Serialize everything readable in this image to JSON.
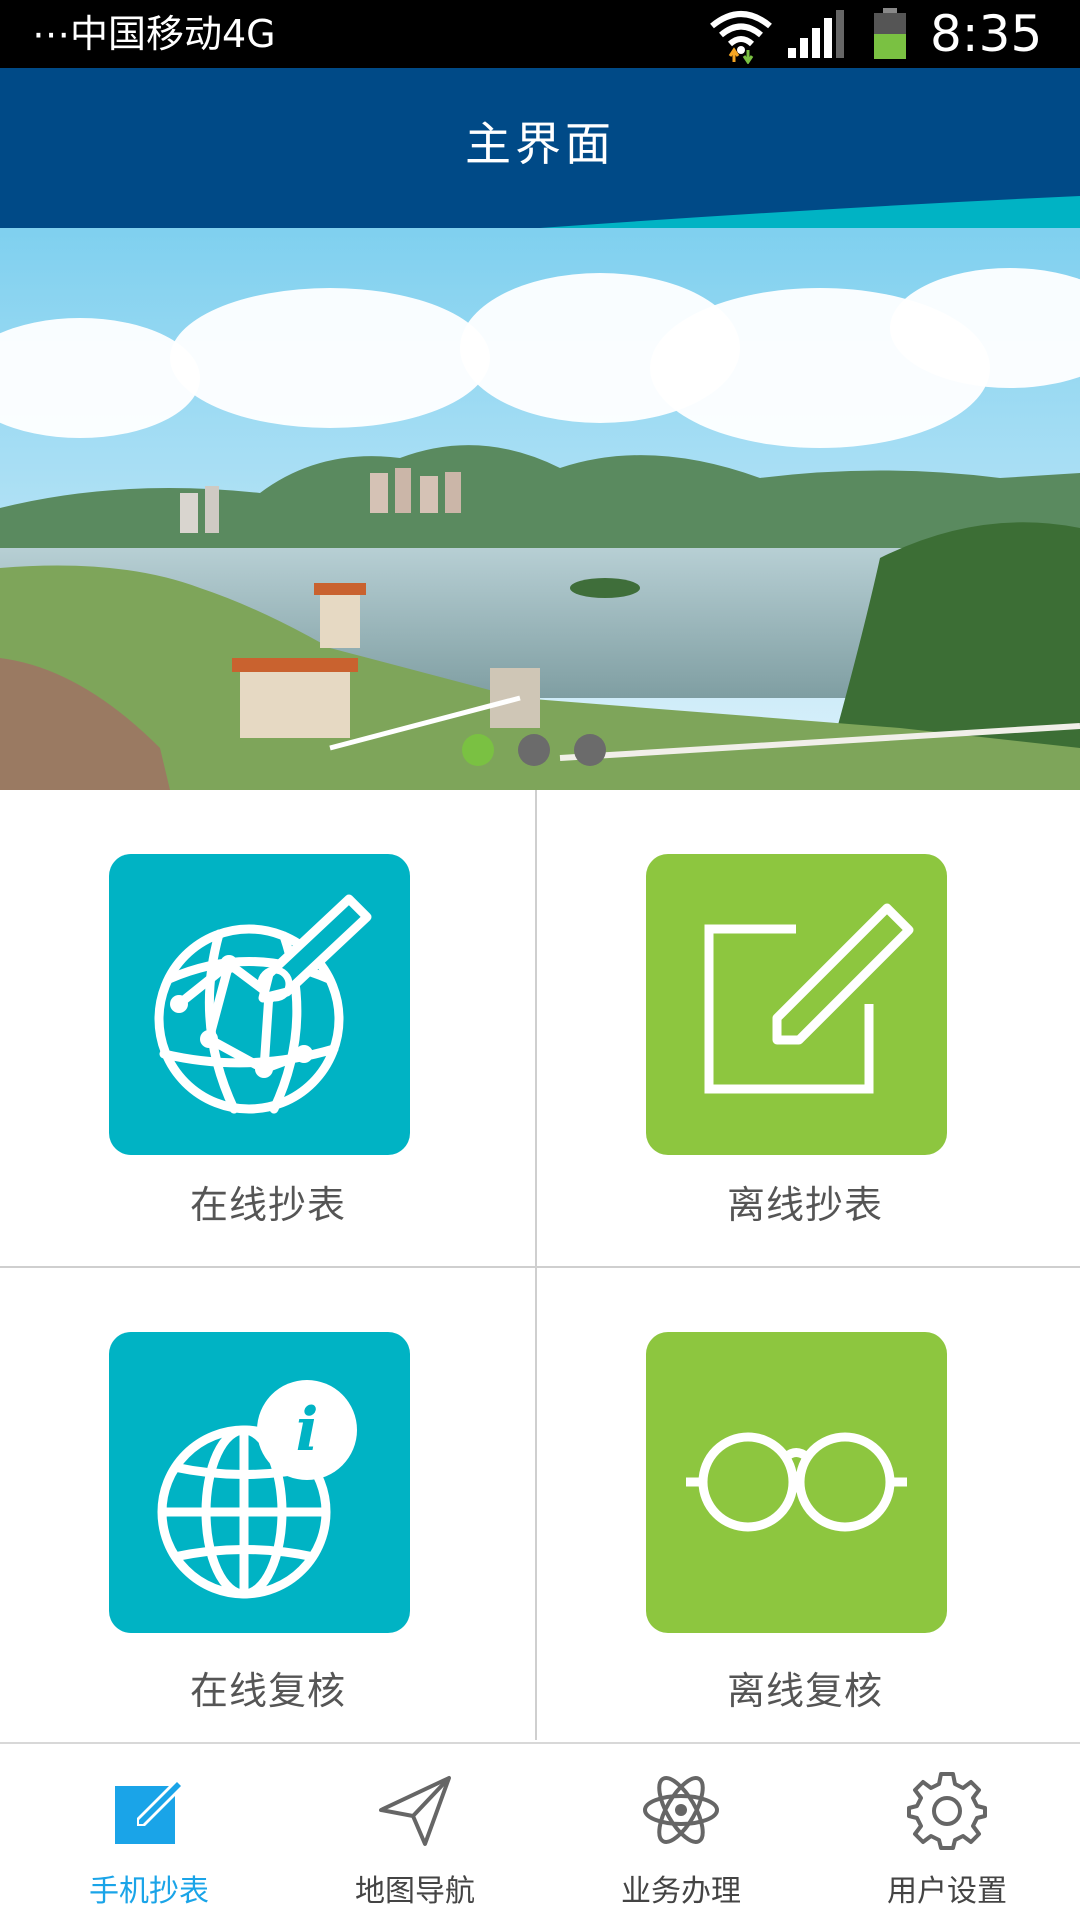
{
  "status_bar": {
    "carrier": "⋯中国移动4G",
    "time": "8:35",
    "icons": [
      "wifi-icon",
      "signal-icon",
      "battery-icon"
    ]
  },
  "header": {
    "title": "主界面",
    "colors": {
      "primary": "#004a87",
      "wave_teal": "#00b3c4",
      "wave_green": "#6cc24a"
    }
  },
  "banner": {
    "slide_count": 3,
    "active_slide": 1
  },
  "tiles": [
    {
      "label": "在线抄表",
      "icon": "globe-pen-icon",
      "color": "#00b3c4"
    },
    {
      "label": "离线抄表",
      "icon": "edit-square-icon",
      "color": "#8dc63f"
    },
    {
      "label": "在线复核",
      "icon": "globe-info-icon",
      "color": "#00b3c4"
    },
    {
      "label": "离线复核",
      "icon": "glasses-icon",
      "color": "#8dc63f"
    }
  ],
  "bottom_nav": {
    "items": [
      {
        "label": "手机抄表",
        "icon": "edit-icon",
        "active": true
      },
      {
        "label": "地图导航",
        "icon": "paper-plane-icon",
        "active": false
      },
      {
        "label": "业务办理",
        "icon": "atom-icon",
        "active": false
      },
      {
        "label": "用户设置",
        "icon": "gear-icon",
        "active": false
      }
    ],
    "active_color": "#1aa4e8",
    "inactive_color": "#444444"
  }
}
